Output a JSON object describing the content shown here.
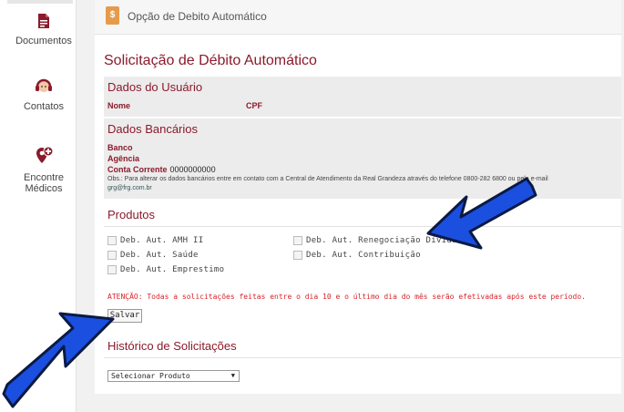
{
  "sidebar": {
    "items": [
      {
        "label": "Documentos",
        "icon": "document-icon"
      },
      {
        "label": "Contatos",
        "icon": "headset-icon"
      },
      {
        "label": "Encontre\nMédicos",
        "icon": "doctor-location-icon"
      }
    ]
  },
  "header": {
    "icon": "dollar-document-icon",
    "title": "Opção de Debito Automático"
  },
  "page": {
    "title": "Solicitação de Débito Automático"
  },
  "user_section": {
    "title": "Dados do Usuário",
    "nome_label": "Nome",
    "cpf_label": "CPF"
  },
  "bank_section": {
    "title": "Dados Bancários",
    "banco_label": "Banco",
    "agencia_label": "Agência",
    "conta_label": "Conta Corrente",
    "conta_value": "0000000000",
    "obs": "Obs.: Para alterar os dados bancários entre em contato com a Central de Atendimento da Real Grandeza através do telefone 0800-282 6800 ou pelo e-mail",
    "email": "grg@frg.com.br"
  },
  "products": {
    "title": "Produtos",
    "items": [
      {
        "label": "Deb. Aut. AMH II",
        "checked": false
      },
      {
        "label": "Deb. Aut. Saúde",
        "checked": false
      },
      {
        "label": "Deb. Aut. Emprestimo",
        "checked": false
      },
      {
        "label": "Deb. Aut. Renegociação Dívida",
        "checked": false
      },
      {
        "label": "Deb. Aut. Contribuição",
        "checked": false
      }
    ]
  },
  "attention": "ATENÇÃO: Todas a solicitações feitas entre o dia 10 e o último dia do mês serão efetivadas após este período.",
  "save_label": "Salvar",
  "history": {
    "title": "Histórico de Solicitações",
    "select_value": "Selecionar Produto"
  },
  "colors": {
    "brand": "#8b1a2b",
    "attention": "#d8232a",
    "arrow": "#1a4fe0",
    "header_icon": "#e69b4b"
  }
}
